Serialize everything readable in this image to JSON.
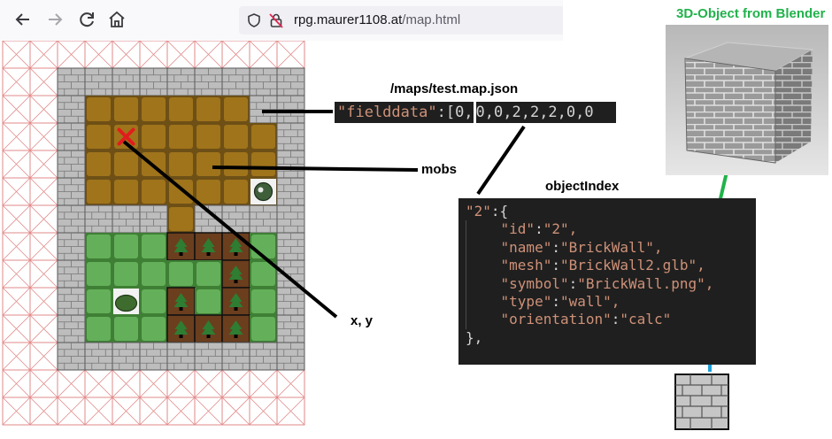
{
  "browser": {
    "url_host": "rpg.maurer1108.at",
    "url_path": "/map.html",
    "icons": [
      "back-arrow-icon",
      "forward-arrow-icon",
      "reload-icon",
      "home-icon",
      "shield-icon",
      "insecure-lock-icon"
    ]
  },
  "annotations": {
    "file_path": "/maps/test.map.json",
    "fielddata_key": "\"fielddata\"",
    "fielddata_open": ":[0,",
    "fielddata_values": "0,0,2,2,2,0,0",
    "mobs_label": "mobs",
    "xy_label": "x, y",
    "object_index_title": "objectIndex",
    "blender_title": "3D-Object from Blender"
  },
  "object_index": {
    "key": "\"2\"",
    "lines": [
      {
        "k": "\"id\"",
        "v": "\"2\","
      },
      {
        "k": "\"name\"",
        "v": "\"BrickWall\","
      },
      {
        "k": "\"mesh\"",
        "v": "\"BrickWall2.glb\","
      },
      {
        "k": "\"symbol\"",
        "v": "\"BrickWall.png\","
      },
      {
        "k": "\"type\"",
        "v": "\"wall\","
      },
      {
        "k": "\"orientation\"",
        "v": "\"calc\""
      }
    ],
    "close": "},"
  },
  "map": {
    "legend": {
      "W": "brick-wall",
      "D": "dirt",
      "G": "grass",
      "T": "tree",
      "X": "void"
    },
    "rows": [
      "WWWWWWWWW",
      "WDDDDDDWW",
      "WDDDDDDDW",
      "WDDDDDDDW",
      "WDDDDDDDW",
      "WWWWDWWWW",
      "WGGGTTTGW",
      "WGGGGGTGW",
      "WGGGTGTGW",
      "WGGGTTTGW",
      "WWWWWWWWW"
    ],
    "mob_cell": [
      4,
      7
    ],
    "bush_cell": [
      8,
      2
    ],
    "target_cell": [
      2,
      2
    ]
  },
  "colors": {
    "accent_green": "#21b24b",
    "accent_blue": "#1a9fd9",
    "dirt": "#a0741b",
    "dirt_border": "#6e5016",
    "grass": "#64b05a",
    "grass_border": "#3f7f35",
    "wall": "#bdbdbd",
    "void_line": "#e28a8a",
    "target": "#e11c1c"
  }
}
